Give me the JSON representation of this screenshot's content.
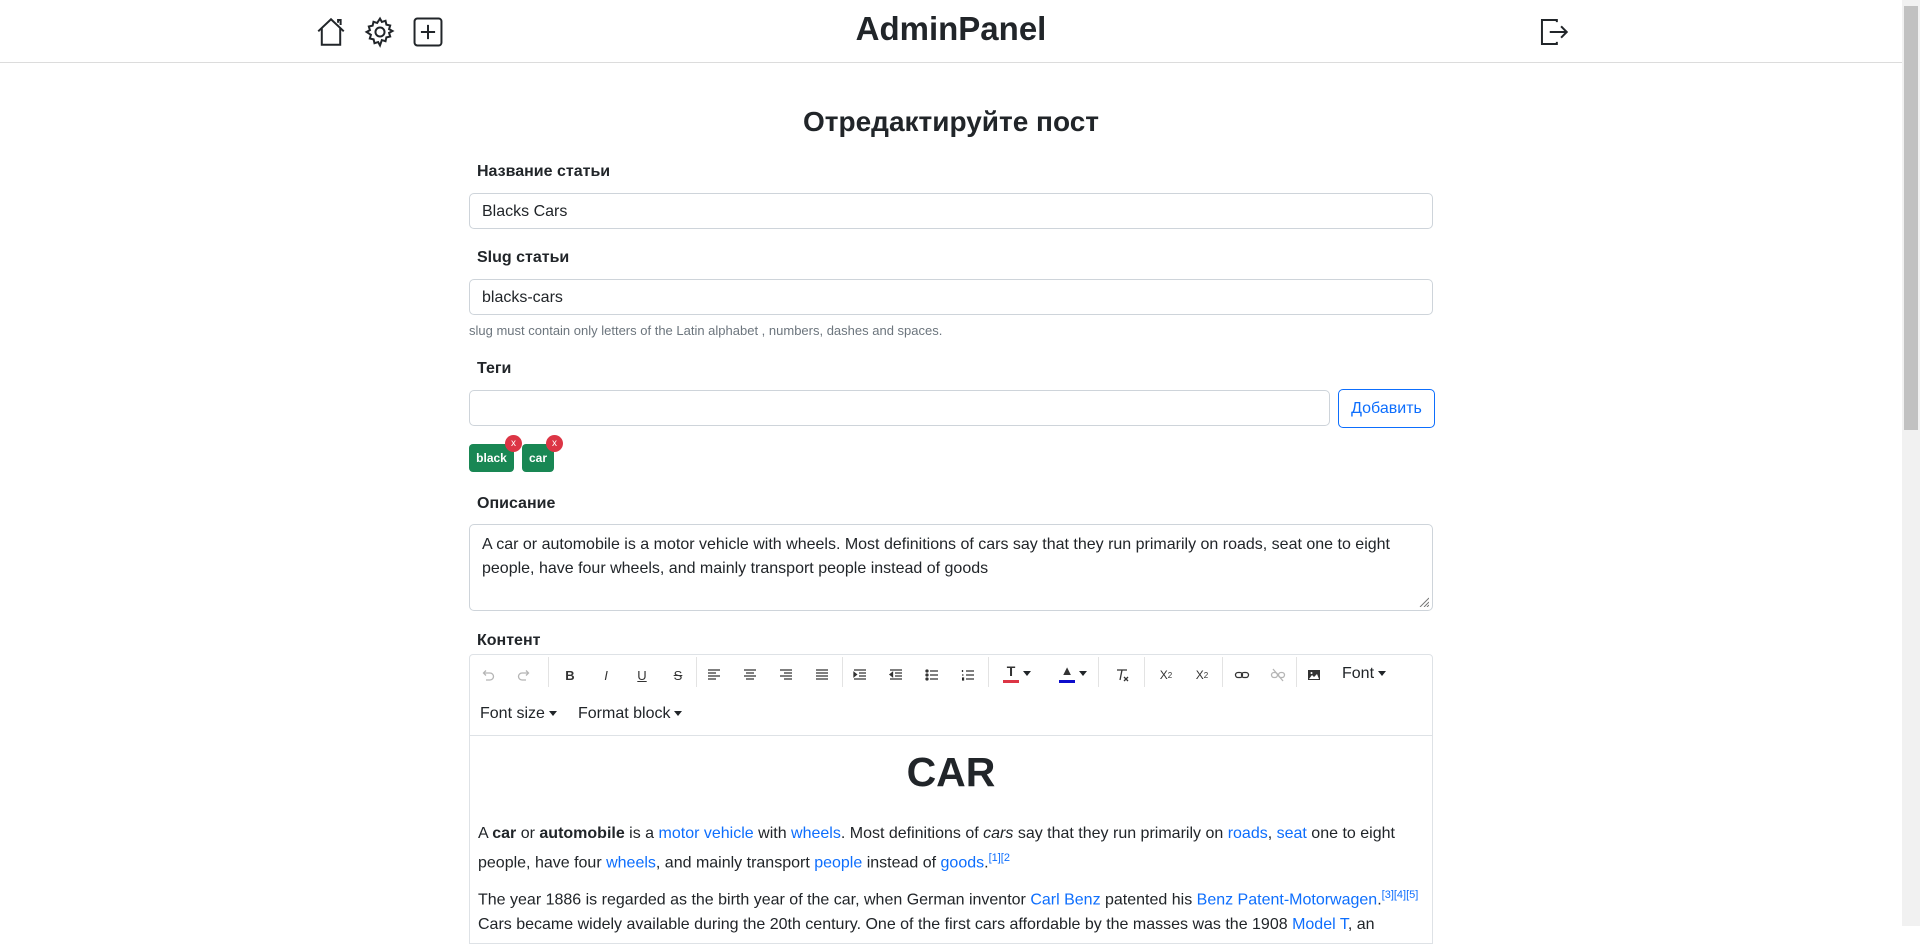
{
  "header": {
    "brand": "AdminPanel",
    "icons": [
      "home-icon",
      "gear-icon",
      "plus-square-icon",
      "logout-icon"
    ]
  },
  "page": {
    "title": "Отредактируйте пост"
  },
  "form": {
    "title_label": "Название статьи",
    "title_value": "Blacks Cars",
    "slug_label": "Slug статьи",
    "slug_value": "blacks-cars",
    "slug_hint": "slug must contain only letters of the Latin alphabet , numbers, dashes and spaces.",
    "tags_label": "Теги",
    "tags_input_value": "",
    "add_button": "Добавить",
    "tags": [
      {
        "label": "black",
        "remove": "x"
      },
      {
        "label": "car",
        "remove": "x"
      }
    ],
    "description_label": "Описание",
    "description_value": "A car or automobile is a motor vehicle with wheels. Most definitions of cars say that they run primarily on roads, seat one to eight people, have four wheels, and mainly transport people instead of goods",
    "content_label": "Контент"
  },
  "editor": {
    "toolbar": {
      "font": "Font",
      "font_size": "Font size",
      "format_block": "Format block",
      "text_color": "#dc3545",
      "highlight_color": "#0d0dcc"
    },
    "heading": "CAR",
    "p1": {
      "t1": "A ",
      "b1": "car",
      "t2": " or ",
      "b2": "automobile",
      "t3": " is a ",
      "l1": "motor vehicle",
      "t4": " with ",
      "l2": "wheels",
      "t5": ". Most definitions of ",
      "i1": "cars",
      "t6": " say that they run primarily on ",
      "l3": "roads",
      "t7": ", ",
      "l4": "seat",
      "t8": " one to eight people, have four ",
      "l5": "wheels",
      "t9": ", and mainly transport ",
      "l6": "people",
      "t10": " instead of ",
      "l7": "goods",
      "t11": ".",
      "s1": "[1][2"
    },
    "p2": {
      "t1": "The year 1886 is regarded as the birth year of the car, when German inventor ",
      "l1": "Carl Benz",
      "t2": " patented his ",
      "l2": "Benz Patent-Motorwagen",
      "t3": ".",
      "s1": "[3][4][5]",
      "t4": "Cars became widely available during the 20th century. One of the first cars affordable by the masses was the 1908 ",
      "l3": "Model T",
      "t5": ", an"
    }
  }
}
